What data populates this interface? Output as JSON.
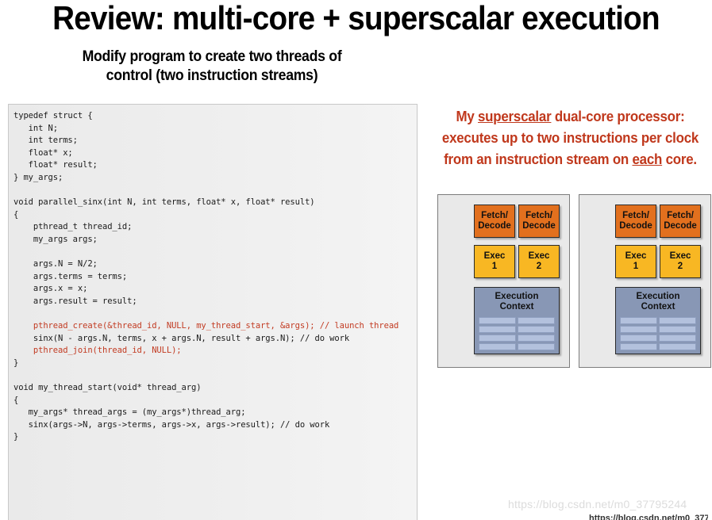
{
  "slide": {
    "title": "Review: multi-core + superscalar execution",
    "subtitle_lines": [
      "Modify program to create two threads of",
      "control (two instruction streams)"
    ]
  },
  "code": {
    "language": "C",
    "lines": [
      {
        "text": "typedef struct {",
        "highlight": false
      },
      {
        "text": "   int N;",
        "highlight": false
      },
      {
        "text": "   int terms;",
        "highlight": false
      },
      {
        "text": "   float* x;",
        "highlight": false
      },
      {
        "text": "   float* result;",
        "highlight": false
      },
      {
        "text": "} my_args;",
        "highlight": false
      },
      {
        "text": "",
        "highlight": false
      },
      {
        "text": "void parallel_sinx(int N, int terms, float* x, float* result)",
        "highlight": false
      },
      {
        "text": "{",
        "highlight": false
      },
      {
        "text": "    pthread_t thread_id;",
        "highlight": false
      },
      {
        "text": "    my_args args;",
        "highlight": false
      },
      {
        "text": "",
        "highlight": false
      },
      {
        "text": "    args.N = N/2;",
        "highlight": false
      },
      {
        "text": "    args.terms = terms;",
        "highlight": false
      },
      {
        "text": "    args.x = x;",
        "highlight": false
      },
      {
        "text": "    args.result = result;",
        "highlight": false
      },
      {
        "text": "",
        "highlight": false
      },
      {
        "text": "    pthread_create(&thread_id, NULL, my_thread_start, &args); // launch thread",
        "highlight": true
      },
      {
        "text": "    sinx(N - args.N, terms, x + args.N, result + args.N); // do work",
        "highlight": false
      },
      {
        "text": "    pthread_join(thread_id, NULL);",
        "highlight": true
      },
      {
        "text": "}",
        "highlight": false
      },
      {
        "text": "",
        "highlight": false
      },
      {
        "text": "void my_thread_start(void* thread_arg)",
        "highlight": false
      },
      {
        "text": "{",
        "highlight": false
      },
      {
        "text": "   my_args* thread_args = (my_args*)thread_arg;",
        "highlight": false
      },
      {
        "text": "   sinx(args->N, args->terms, args->x, args->result); // do work",
        "highlight": false
      },
      {
        "text": "}",
        "highlight": false
      }
    ]
  },
  "processor": {
    "caption_lines": [
      [
        {
          "text": "My ",
          "underline": false
        },
        {
          "text": "superscalar",
          "underline": true
        },
        {
          "text": " dual-core processor:",
          "underline": false
        }
      ],
      [
        {
          "text": "executes up to two instructions per clock",
          "underline": false
        }
      ],
      [
        {
          "text": "from an instruction stream on ",
          "underline": false
        },
        {
          "text": "each",
          "underline": true
        },
        {
          "text": " core.",
          "underline": false
        }
      ]
    ],
    "cores": [
      {
        "name": "core-1",
        "fetch_decode": [
          {
            "line1": "Fetch/",
            "line2": "Decode"
          },
          {
            "line1": "Fetch/",
            "line2": "Decode"
          }
        ],
        "exec_units": [
          {
            "line1": "Exec",
            "line2": "1"
          },
          {
            "line1": "Exec",
            "line2": "2"
          }
        ],
        "execution_context": {
          "line1": "Execution",
          "line2": "Context",
          "grid_cols": 2,
          "grid_rows": 4
        }
      },
      {
        "name": "core-2",
        "fetch_decode": [
          {
            "line1": "Fetch/",
            "line2": "Decode"
          },
          {
            "line1": "Fetch/",
            "line2": "Decode"
          }
        ],
        "exec_units": [
          {
            "line1": "Exec",
            "line2": "1"
          },
          {
            "line1": "Exec",
            "line2": "2"
          }
        ],
        "execution_context": {
          "line1": "Execution",
          "line2": "Context",
          "grid_cols": 2,
          "grid_rows": 4
        }
      }
    ],
    "colors": {
      "fetch_decode": "#e2701e",
      "exec": "#f8b723",
      "execution_context": "#8897b5",
      "context_cell": "#b3c1dd",
      "core_background": "#e9e9e9",
      "caption_text": "#c0381c"
    }
  },
  "watermark": {
    "text": "https://blog.csdn.net/m0_37795244"
  }
}
